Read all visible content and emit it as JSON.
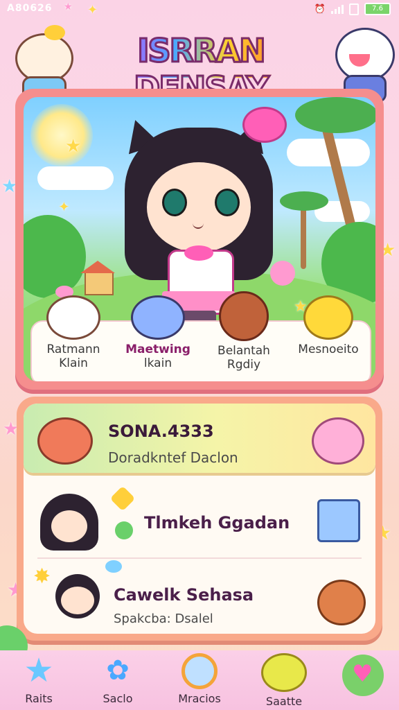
{
  "status_bar": {
    "time": "A80626",
    "battery": "7.6"
  },
  "title": "ISRRAN DENSAY",
  "companions": [
    {
      "line1": "Ratmann",
      "line2": "Klain",
      "color": "#ffffff"
    },
    {
      "line1": "Maetwing",
      "line2": "lkain",
      "color": "#8fb3ff"
    },
    {
      "line1": "Belantah",
      "line2": "Rgdiy",
      "color": "#c0623a"
    },
    {
      "line1": "Mesnoeito",
      "line2": "",
      "color": "#ffd93a"
    }
  ],
  "list": {
    "highlight": {
      "title": "SONA.4333",
      "subtitle": "Doradkntef Daclon"
    },
    "rows": [
      {
        "title": "Tlmkeh Ggadan",
        "subtitle": ""
      },
      {
        "title": "Cawelk Sehasa",
        "subtitle": "Spakcba: Dsalel"
      }
    ]
  },
  "nav": [
    {
      "label": "Raits",
      "icon": "star-icon"
    },
    {
      "label": "Saclo",
      "icon": "magic-wand-icon"
    },
    {
      "label": "Mracios",
      "icon": "mirror-icon"
    },
    {
      "label": "Saatte",
      "icon": "bear-icon"
    }
  ],
  "colors": {
    "accent": "#ff5fb7",
    "panel": "#f58e8e",
    "highlight": "#c8ecb0"
  }
}
